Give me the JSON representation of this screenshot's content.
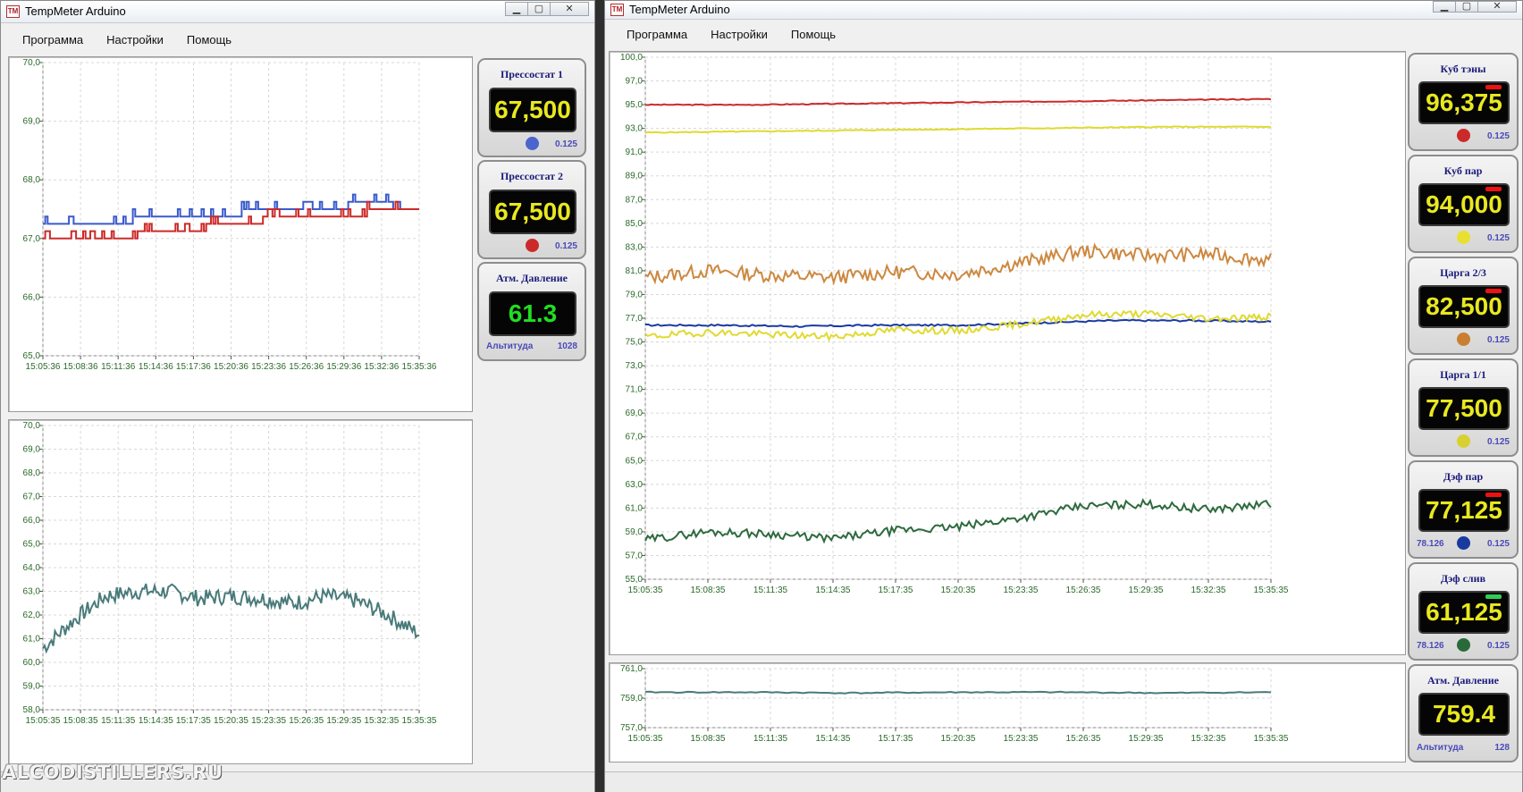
{
  "window_left": {
    "title": "TempMeter Arduino",
    "menu": [
      "Программа",
      "Настройки",
      "Помощь"
    ],
    "chart_top": {
      "y_ticks": [
        "70,0",
        "69,0",
        "68,0",
        "67,0",
        "66,0",
        "65,0"
      ],
      "x_ticks": [
        "15:05:36",
        "15:08:36",
        "15:11:36",
        "15:14:36",
        "15:17:36",
        "15:20:36",
        "15:23:36",
        "15:26:36",
        "15:29:36",
        "15:32:36",
        "15:35:36"
      ]
    },
    "chart_bottom": {
      "y_ticks": [
        "70,0",
        "69,0",
        "68,0",
        "67,0",
        "66,0",
        "65,0",
        "64,0",
        "63,0",
        "62,0",
        "61,0",
        "60,0",
        "59,0",
        "58,0"
      ],
      "x_ticks": [
        "15:05:35",
        "15:08:35",
        "15:11:35",
        "15:14:35",
        "15:17:35",
        "15:20:35",
        "15:23:35",
        "15:26:35",
        "15:29:35",
        "15:32:35",
        "15:35:35"
      ]
    },
    "gauges": [
      {
        "title": "Прессостат 1",
        "value": "67,500",
        "res": "0.125",
        "dot": "#4a66cc"
      },
      {
        "title": "Прессостат 2",
        "value": "67,500",
        "res": "0.125",
        "dot": "#cc2a2a"
      },
      {
        "title": "Атм. Давление",
        "value": "61.3",
        "left": "Альтитуда",
        "right": "1028",
        "value_color": "#22dd22"
      }
    ]
  },
  "window_right": {
    "title": "TempMeter Arduino",
    "menu": [
      "Программа",
      "Настройки",
      "Помощь"
    ],
    "chart_main": {
      "y_ticks": [
        "100,0",
        "97,0",
        "95,0",
        "93,0",
        "91,0",
        "89,0",
        "87,0",
        "85,0",
        "83,0",
        "81,0",
        "79,0",
        "77,0",
        "75,0",
        "73,0",
        "71,0",
        "69,0",
        "67,0",
        "65,0",
        "63,0",
        "61,0",
        "59,0",
        "57,0",
        "55,0"
      ],
      "x_ticks": [
        "15:05:35",
        "15:08:35",
        "15:11:35",
        "15:14:35",
        "15:17:35",
        "15:20:35",
        "15:23:35",
        "15:26:35",
        "15:29:35",
        "15:32:35",
        "15:35:35"
      ]
    },
    "chart_pressure": {
      "y_ticks": [
        "761,0",
        "759,0",
        "757,0"
      ],
      "x_ticks": [
        "15:05:35",
        "15:08:35",
        "15:11:35",
        "15:14:35",
        "15:17:35",
        "15:20:35",
        "15:23:35",
        "15:26:35",
        "15:29:35",
        "15:32:35",
        "15:35:35"
      ]
    },
    "gauges": [
      {
        "title": "Куб тэны",
        "value": "96,375",
        "res": "0.125",
        "dot": "#cc2a2a",
        "bar": "#ee1111"
      },
      {
        "title": "Куб пар",
        "value": "94,000",
        "res": "0.125",
        "dot": "#e8e030",
        "bar": "#ee1111"
      },
      {
        "title": "Царга 2/3",
        "value": "82,500",
        "res": "0.125",
        "dot": "#c88030",
        "bar": "#ee1111"
      },
      {
        "title": "Царга 1/1",
        "value": "77,500",
        "res": "0.125",
        "dot": "#d8d030"
      },
      {
        "title": "Дэф пар",
        "value": "77,125",
        "res": "0.125",
        "dot": "#1a3aa0",
        "bar": "#ee1111",
        "left": "78.126"
      },
      {
        "title": "Дэф слив",
        "value": "61,125",
        "res": "0.125",
        "dot": "#2a6a3a",
        "bar": "#33cc55",
        "left": "78.126"
      },
      {
        "title": "Атм. Давление",
        "value": "759.4",
        "left": "Альтитуда",
        "right": "128"
      }
    ]
  },
  "watermark": "ALCODISTILLERS.RU",
  "colors": {
    "red": "#cc2a2a",
    "blue": "#3a5acc",
    "yellow": "#e0da30",
    "orange": "#cc8840",
    "navy": "#1a3aa0",
    "green": "#2e6a3e",
    "teal": "#4a7a7a",
    "axis": "#2a6a2a"
  }
}
